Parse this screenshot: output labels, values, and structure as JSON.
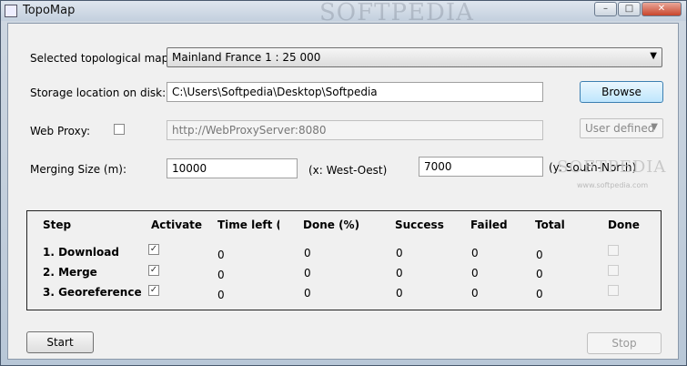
{
  "window": {
    "title": "TopoMap",
    "bg_watermark": "SOFTPEDIA"
  },
  "form": {
    "map_label": "Selected topological map:",
    "map_value": "Mainland France 1 : 25 000",
    "storage_label": "Storage location on disk:",
    "storage_value": "C:\\Users\\Softpedia\\Desktop\\Softpedia",
    "browse_label": "Browse",
    "proxy_label": "Web Proxy:",
    "proxy_placeholder": "http://WebProxyServer:8080",
    "proxy_mode": "User defined",
    "merging_label": "Merging Size (m):",
    "merging_x": "10000",
    "x_hint": "(x: West-Oest)",
    "merging_y": "7000",
    "y_hint": "(y: South-North)"
  },
  "table": {
    "headers": [
      "Step",
      "Activate",
      "Time left (h)",
      "Done (%)",
      "Success",
      "Failed",
      "Total",
      "Done"
    ],
    "rows": [
      {
        "step": "1. Download",
        "time": "0",
        "done_pct": "0",
        "success": "0",
        "failed": "0",
        "total": "0"
      },
      {
        "step": "2. Merge",
        "time": "0",
        "done_pct": "0",
        "success": "0",
        "failed": "0",
        "total": "0"
      },
      {
        "step": "3. Georeference",
        "time": "0",
        "done_pct": "0",
        "success": "0",
        "failed": "0",
        "total": "0"
      }
    ]
  },
  "actions": {
    "start_label": "Start",
    "stop_label": "Stop"
  },
  "watermark": {
    "text": "SOFTPEDIA",
    "url": "www.softpedia.com"
  },
  "icons": [
    "window-icon",
    "minimize-icon",
    "maximize-icon",
    "close-icon",
    "dropdown-arrow-icon",
    "checkmark-icon"
  ],
  "colors": {
    "browse_accent": "#bee6fd",
    "title_bar": "#c3d0de"
  }
}
